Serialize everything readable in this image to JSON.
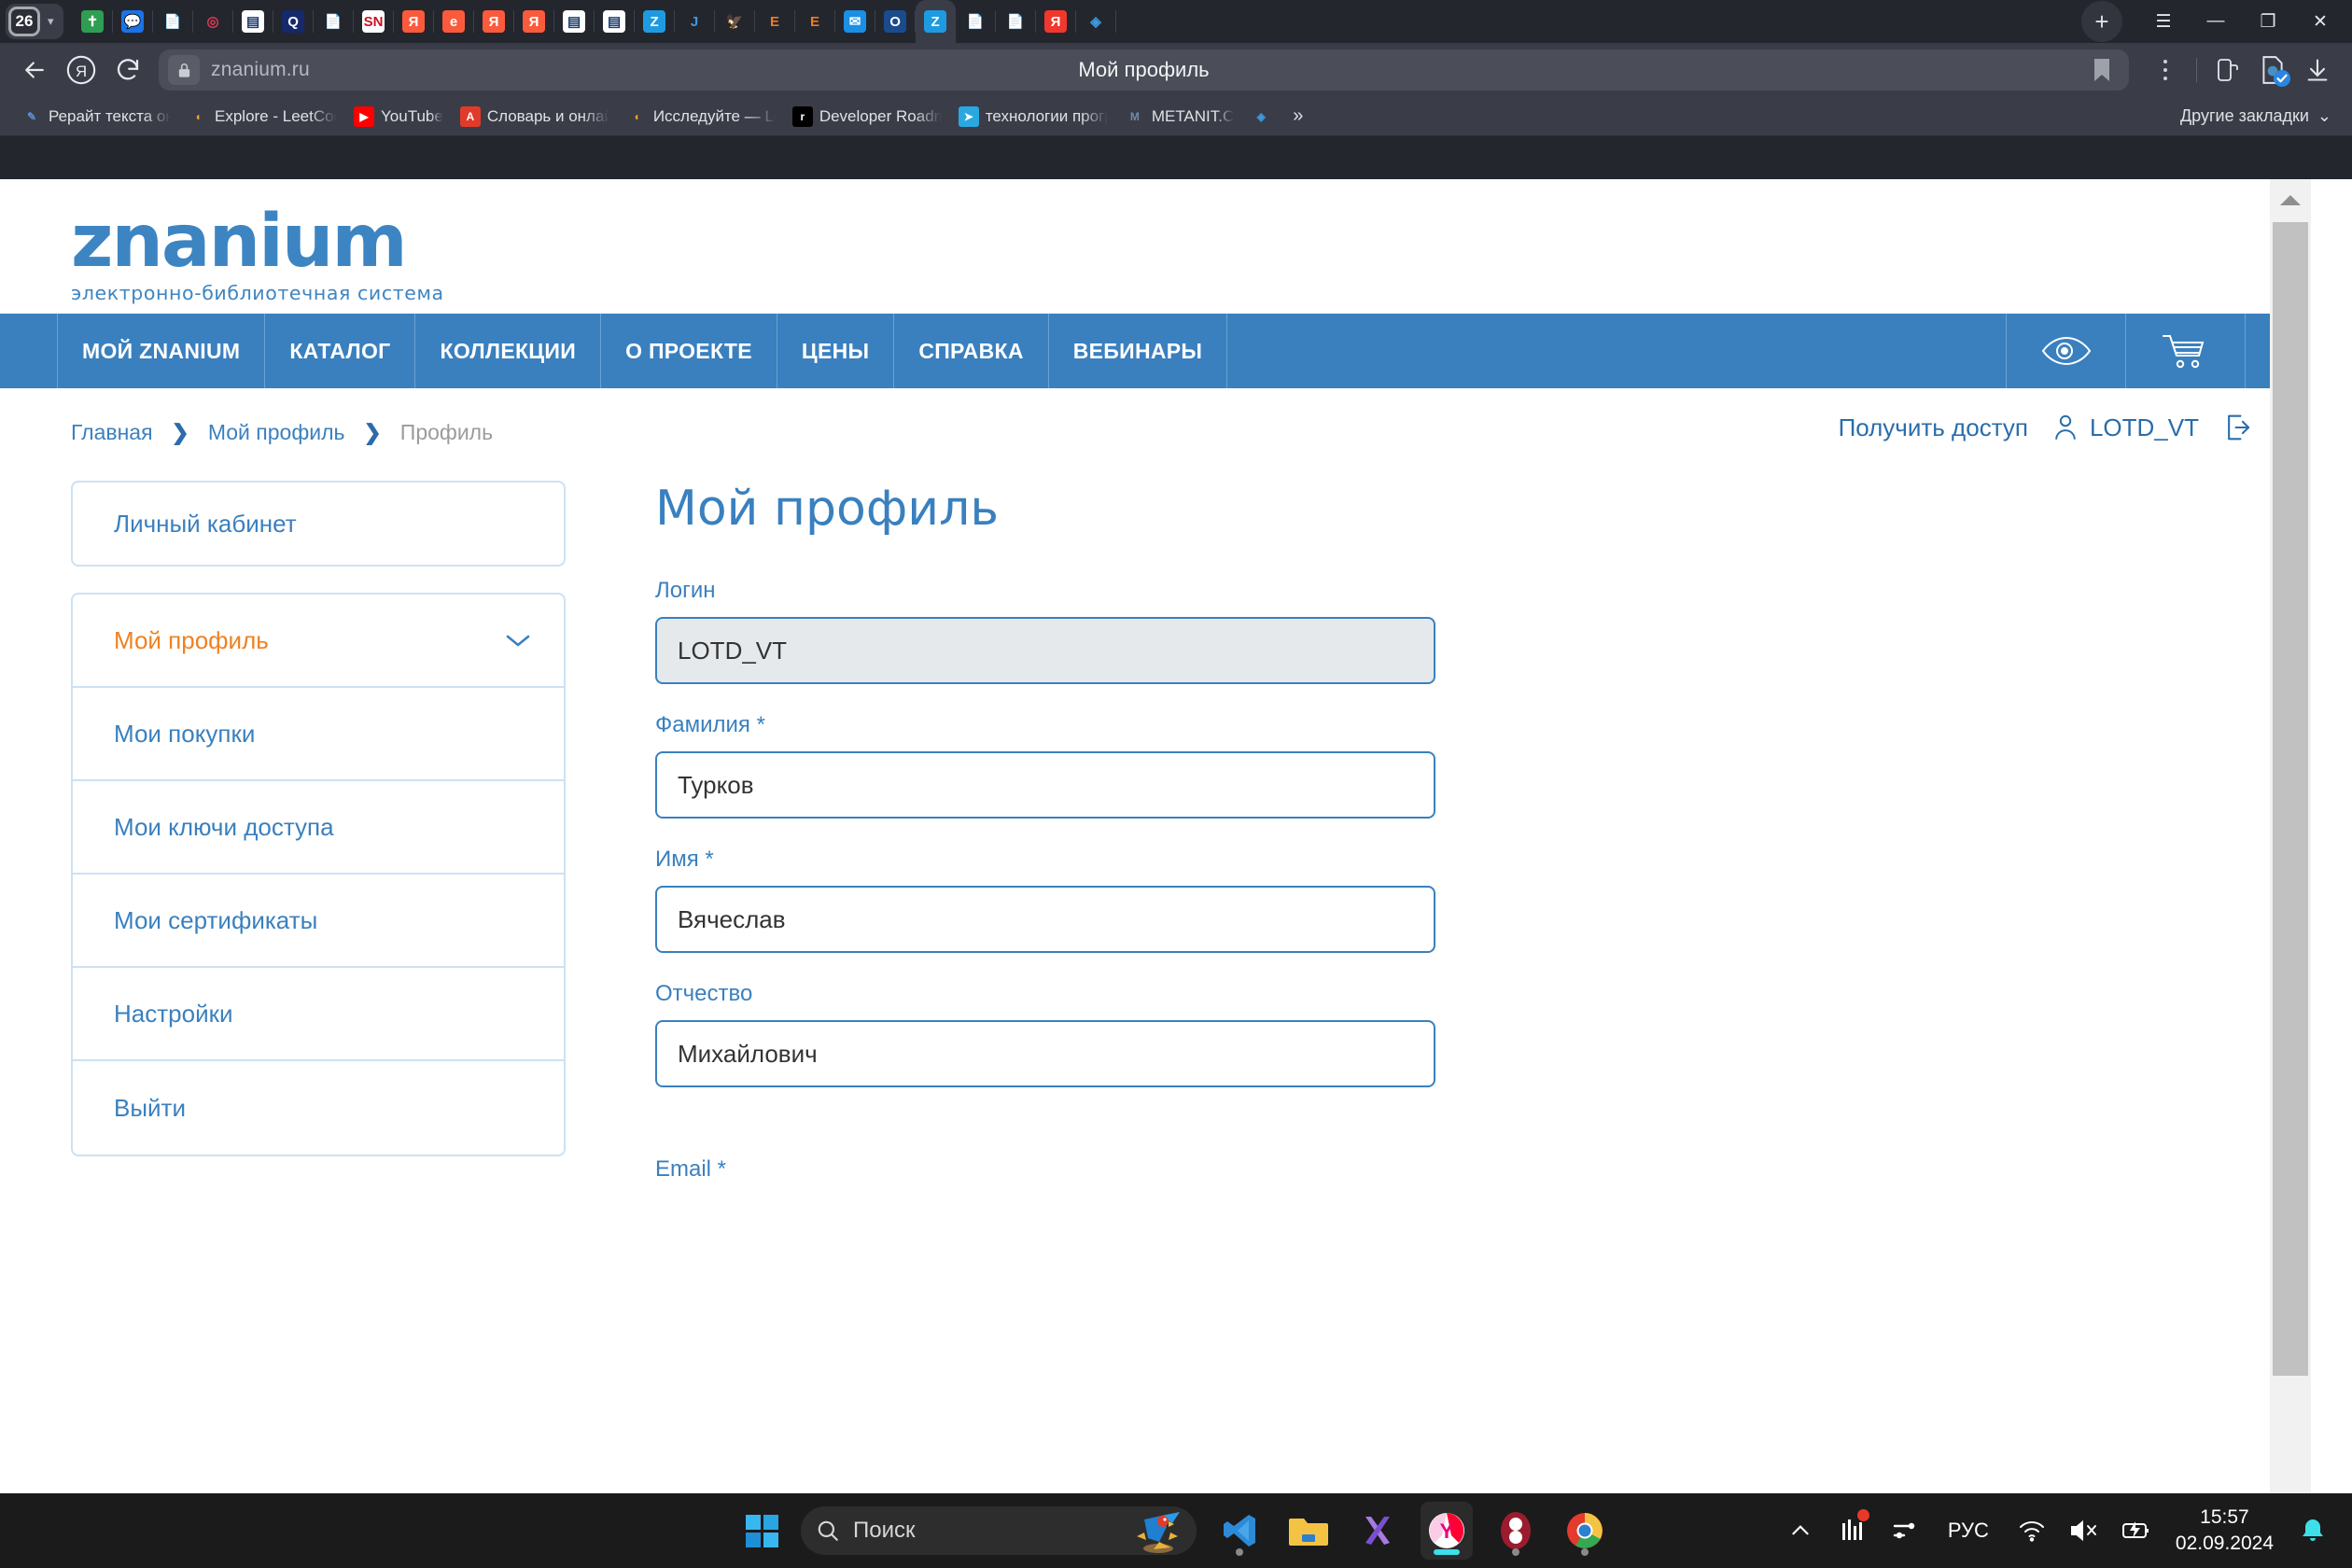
{
  "browser": {
    "tab_count": "26",
    "tabs": [
      {
        "name": "tab-bible",
        "glyph": "✝",
        "bg": "#2e9e52",
        "fg": "#ffffff"
      },
      {
        "name": "tab-messenger",
        "glyph": "💬",
        "bg": "#1a73e8",
        "fg": "#ffffff"
      },
      {
        "name": "tab-document",
        "glyph": "📄",
        "bg": "transparent",
        "fg": "#ffffff"
      },
      {
        "name": "tab-coil",
        "glyph": "◎",
        "bg": "transparent",
        "fg": "#e03b52"
      },
      {
        "name": "tab-qr",
        "glyph": "▤",
        "bg": "#ffffff",
        "fg": "#1a3a6b"
      },
      {
        "name": "tab-quizlet",
        "glyph": "Q",
        "bg": "#15296b",
        "fg": "#ffffff"
      },
      {
        "name": "tab-document-2",
        "glyph": "📄",
        "bg": "transparent",
        "fg": "#ffffff"
      },
      {
        "name": "tab-sn",
        "glyph": "SN",
        "bg": "#ffffff",
        "fg": "#cc1122"
      },
      {
        "name": "tab-yandex-1",
        "glyph": "Я",
        "bg": "#fc5a3c",
        "fg": "#ffffff"
      },
      {
        "name": "tab-edge",
        "glyph": "e",
        "bg": "#fc5a3c",
        "fg": "#ffffff"
      },
      {
        "name": "tab-yandex-2",
        "glyph": "Я",
        "bg": "#fc5a3c",
        "fg": "#ffffff"
      },
      {
        "name": "tab-yandex-3",
        "glyph": "Я",
        "bg": "#fc5a3c",
        "fg": "#ffffff"
      },
      {
        "name": "tab-qr-2",
        "glyph": "▤",
        "bg": "#ffffff",
        "fg": "#1a3a6b"
      },
      {
        "name": "tab-qr-3",
        "glyph": "▤",
        "bg": "#ffffff",
        "fg": "#1a3a6b"
      },
      {
        "name": "tab-znanium-1",
        "glyph": "Z",
        "bg": "#1e9be0",
        "fg": "#ffffff"
      },
      {
        "name": "tab-jira",
        "glyph": "J",
        "bg": "transparent",
        "fg": "#3d9ae0"
      },
      {
        "name": "tab-gerb",
        "glyph": "🦅",
        "bg": "transparent",
        "fg": "#c9c9c9"
      },
      {
        "name": "tab-e-library-1",
        "glyph": "E",
        "bg": "transparent",
        "fg": "#ee7b1e"
      },
      {
        "name": "tab-e-library-2",
        "glyph": "E",
        "bg": "transparent",
        "fg": "#ee7b1e"
      },
      {
        "name": "tab-mail",
        "glyph": "✉",
        "bg": "#1a8fe3",
        "fg": "#ffffff"
      },
      {
        "name": "tab-outlook",
        "glyph": "O",
        "bg": "#1a4b8c",
        "fg": "#ffffff"
      },
      {
        "name": "tab-znanium-active",
        "glyph": "Z",
        "bg": "#1e9be0",
        "fg": "#ffffff"
      },
      {
        "name": "tab-document-3",
        "glyph": "📄",
        "bg": "transparent",
        "fg": "#ffffff"
      },
      {
        "name": "tab-document-4",
        "glyph": "📄",
        "bg": "transparent",
        "fg": "#ffffff"
      },
      {
        "name": "tab-yandex-4",
        "glyph": "Я",
        "bg": "#f2372d",
        "fg": "#ffffff"
      },
      {
        "name": "tab-alice",
        "glyph": "◈",
        "bg": "transparent",
        "fg": "#3d9ae0"
      }
    ],
    "active_tab_index": 21,
    "new_tab_label": "+",
    "window_controls": {
      "menu": "☰",
      "minimize": "—",
      "restore": "❐",
      "close": "✕"
    },
    "address": {
      "url": "znanium.ru",
      "page_title": "Мой профиль"
    },
    "bookmarks": [
      {
        "label": "Рерайт текста онл",
        "bg": "#3a3d47",
        "glyph": "✎",
        "fg": "#5b8fd4"
      },
      {
        "label": "Explore - LeetCode",
        "bg": "#3a3d47",
        "glyph": "◖",
        "fg": "#f5a623"
      },
      {
        "label": "YouTube",
        "bg": "#ff0000",
        "glyph": "▶",
        "fg": "#ffffff"
      },
      {
        "label": "Словарь и онлайн",
        "bg": "#e03b2a",
        "glyph": "A",
        "fg": "#ffffff"
      },
      {
        "label": "Исследуйте — Lee",
        "bg": "#3a3d47",
        "glyph": "◖",
        "fg": "#f5a623"
      },
      {
        "label": "Developer Roadma",
        "bg": "#000000",
        "glyph": "r",
        "fg": "#ffffff"
      },
      {
        "label": "технологии програ",
        "bg": "#29a8e0",
        "glyph": "➤",
        "fg": "#ffffff"
      },
      {
        "label": "METANIT.C",
        "bg": "#3a3d47",
        "glyph": "M",
        "fg": "#6f8ba8"
      },
      {
        "label": "",
        "bg": "#3a3d47",
        "glyph": "◈",
        "fg": "#3d9ae0"
      }
    ],
    "bookmarks_overflow": "»",
    "other_bookmarks": "Другие закладки"
  },
  "site": {
    "logo": {
      "name": "znanium",
      "tagline": "электронно-библиотечная система"
    },
    "header_right": {
      "get_access": "Получить доступ",
      "username": "LOTD_VT"
    },
    "nav": [
      {
        "label": "МОЙ ZNANIUM"
      },
      {
        "label": "КАТАЛОГ"
      },
      {
        "label": "КОЛЛЕКЦИИ"
      },
      {
        "label": "О ПРОЕКТЕ"
      },
      {
        "label": "ЦЕНЫ"
      },
      {
        "label": "СПРАВКА"
      },
      {
        "label": "ВЕБИНАРЫ"
      }
    ],
    "breadcrumb": [
      {
        "label": "Главная",
        "current": false
      },
      {
        "label": "Мой профиль",
        "current": false
      },
      {
        "label": "Профиль",
        "current": true
      }
    ],
    "sidebar": {
      "heading": "Личный кабинет",
      "items": [
        {
          "label": "Мой профиль",
          "active": true,
          "chevron": true
        },
        {
          "label": "Мои покупки",
          "active": false,
          "chevron": false
        },
        {
          "label": "Мои ключи доступа",
          "active": false,
          "chevron": false
        },
        {
          "label": "Мои сертификаты",
          "active": false,
          "chevron": false
        },
        {
          "label": "Настройки",
          "active": false,
          "chevron": false
        },
        {
          "label": "Выйти",
          "active": false,
          "chevron": false
        }
      ]
    },
    "form": {
      "title": "Мой профиль",
      "fields": [
        {
          "label": "Логин",
          "value": "LOTD_VT",
          "readonly": true
        },
        {
          "label": "Фамилия *",
          "value": "Турков",
          "readonly": false
        },
        {
          "label": "Имя *",
          "value": "Вячеслав",
          "readonly": false
        },
        {
          "label": "Отчество",
          "value": "Михайлович",
          "readonly": false
        }
      ],
      "next_label": "Email *"
    },
    "colors": {
      "brand_blue": "#3a80bf",
      "accent_orange": "#f08122",
      "link_blue": "#2b6cab"
    }
  },
  "taskbar": {
    "search_placeholder": "Поиск",
    "apps": [
      {
        "name": "vs-code",
        "running": false
      },
      {
        "name": "file-explorer",
        "running": false
      },
      {
        "name": "visual-studio",
        "running": false
      },
      {
        "name": "yandex-browser",
        "running": true
      },
      {
        "name": "octave",
        "running": false
      },
      {
        "name": "google-chrome",
        "running": false
      }
    ],
    "language": "РУС",
    "time": "15:57",
    "date": "02.09.2024"
  }
}
